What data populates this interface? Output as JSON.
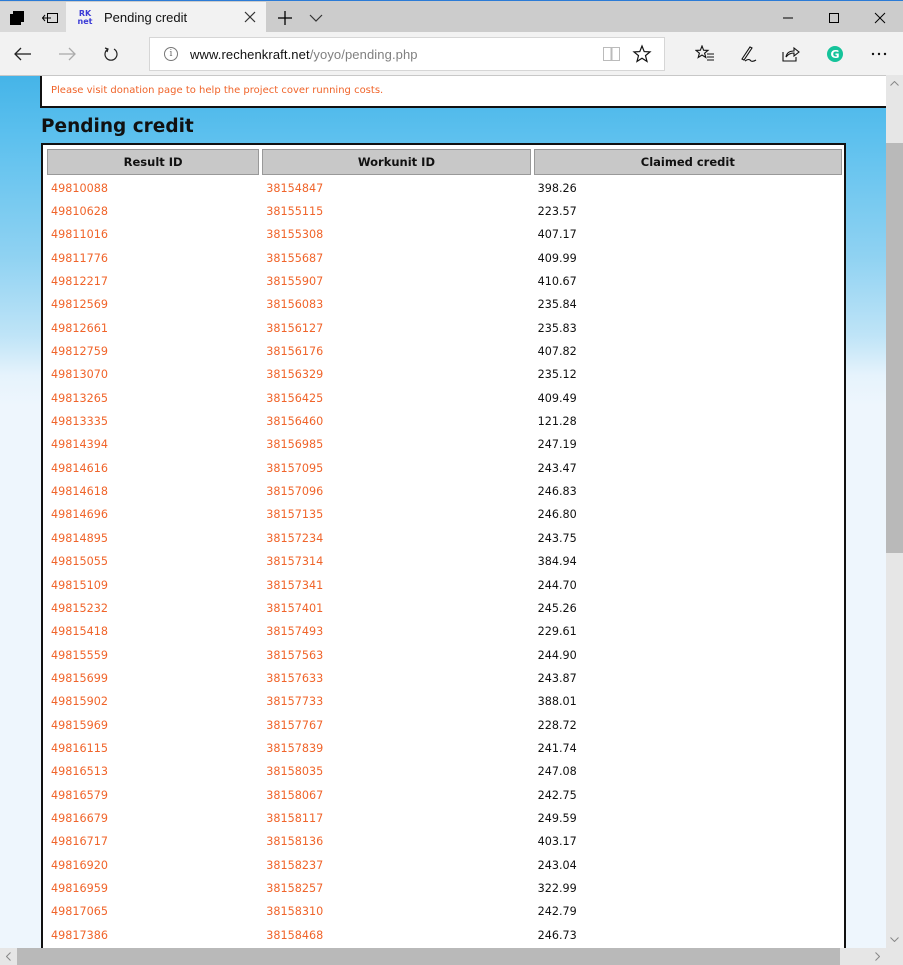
{
  "browser": {
    "tab": {
      "favicon_line1": "RK",
      "favicon_line2": "net",
      "title": "Pending credit"
    },
    "address": {
      "host": "www.rechenkraft.net",
      "path": "/yoyo/pending.php"
    },
    "icons": {
      "set_aside": "tabs-aside-icon",
      "restore_tabs": "restore-tabs-icon",
      "close_tab": "close-icon",
      "new_tab": "plus-icon",
      "tab_list": "chevron-down-icon",
      "minimize": "minimize-icon",
      "maximize": "maximize-icon",
      "close_window": "close-icon",
      "back": "arrow-left-icon",
      "forward": "arrow-right-icon",
      "refresh": "refresh-icon",
      "site_info": "info-icon",
      "reading_view": "book-icon",
      "favorite": "star-icon",
      "favorites_hub": "favorites-list-icon",
      "web_notes": "pen-icon",
      "share": "share-icon",
      "grammarly": "grammarly-icon",
      "more": "more-icon"
    },
    "grammarly_letter": "G"
  },
  "page": {
    "notice": "Please visit donation page to help the project cover running costs.",
    "title": "Pending credit",
    "table": {
      "headers": [
        "Result ID",
        "Workunit ID",
        "Claimed credit"
      ],
      "rows": [
        [
          "49810088",
          "38154847",
          "398.26"
        ],
        [
          "49810628",
          "38155115",
          "223.57"
        ],
        [
          "49811016",
          "38155308",
          "407.17"
        ],
        [
          "49811776",
          "38155687",
          "409.99"
        ],
        [
          "49812217",
          "38155907",
          "410.67"
        ],
        [
          "49812569",
          "38156083",
          "235.84"
        ],
        [
          "49812661",
          "38156127",
          "235.83"
        ],
        [
          "49812759",
          "38156176",
          "407.82"
        ],
        [
          "49813070",
          "38156329",
          "235.12"
        ],
        [
          "49813265",
          "38156425",
          "409.49"
        ],
        [
          "49813335",
          "38156460",
          "121.28"
        ],
        [
          "49814394",
          "38156985",
          "247.19"
        ],
        [
          "49814616",
          "38157095",
          "243.47"
        ],
        [
          "49814618",
          "38157096",
          "246.83"
        ],
        [
          "49814696",
          "38157135",
          "246.80"
        ],
        [
          "49814895",
          "38157234",
          "243.75"
        ],
        [
          "49815055",
          "38157314",
          "384.94"
        ],
        [
          "49815109",
          "38157341",
          "244.70"
        ],
        [
          "49815232",
          "38157401",
          "245.26"
        ],
        [
          "49815418",
          "38157493",
          "229.61"
        ],
        [
          "49815559",
          "38157563",
          "244.90"
        ],
        [
          "49815699",
          "38157633",
          "243.87"
        ],
        [
          "49815902",
          "38157733",
          "388.01"
        ],
        [
          "49815969",
          "38157767",
          "228.72"
        ],
        [
          "49816115",
          "38157839",
          "241.74"
        ],
        [
          "49816513",
          "38158035",
          "247.08"
        ],
        [
          "49816579",
          "38158067",
          "242.75"
        ],
        [
          "49816679",
          "38158117",
          "249.59"
        ],
        [
          "49816717",
          "38158136",
          "403.17"
        ],
        [
          "49816920",
          "38158237",
          "243.04"
        ],
        [
          "49816959",
          "38158257",
          "322.99"
        ],
        [
          "49817065",
          "38158310",
          "242.79"
        ],
        [
          "49817386",
          "38158468",
          "246.73"
        ]
      ]
    }
  },
  "colors": {
    "link": "#f0642a",
    "header_bg": "#c8c8c8",
    "page_bg_top": "#45b4e8",
    "page_bg_bottom": "#eef6fd",
    "grammarly": "#15c39a"
  }
}
